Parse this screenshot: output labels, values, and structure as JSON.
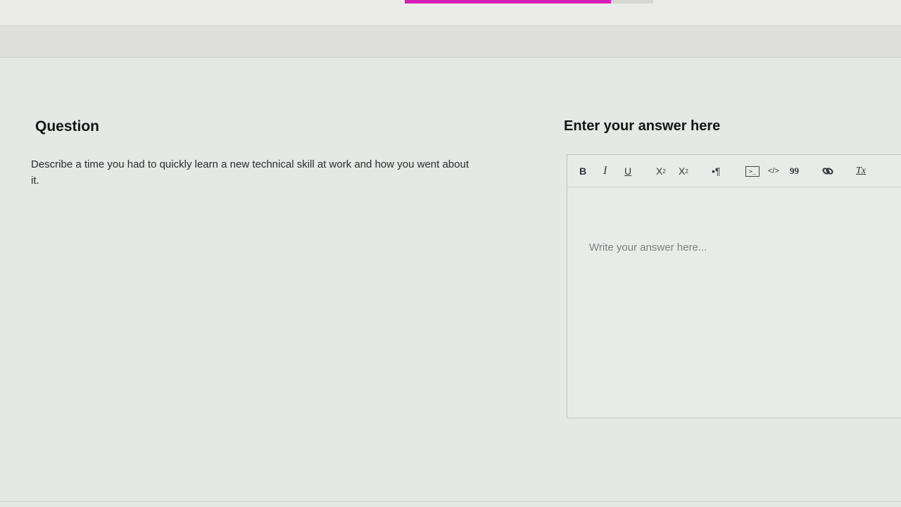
{
  "progress": {
    "fraction": 0.83,
    "fill_color": "#d61fb4"
  },
  "question": {
    "heading": "Question",
    "text": "Describe a time you had to quickly learn a new technical skill at work and how you went about it."
  },
  "answer": {
    "heading": "Enter your answer here",
    "placeholder": "Write your answer here...",
    "value": ""
  },
  "toolbar": {
    "bold": "B",
    "italic": "I",
    "underline": "U",
    "subscript": "X",
    "subscript_mark": "2",
    "superscript": "X",
    "superscript_mark": "2",
    "paragraph": "•¶",
    "code_block": ">_",
    "code_inline": "</>",
    "quote": "99",
    "link": "🔗",
    "clear_format": "Tx"
  }
}
